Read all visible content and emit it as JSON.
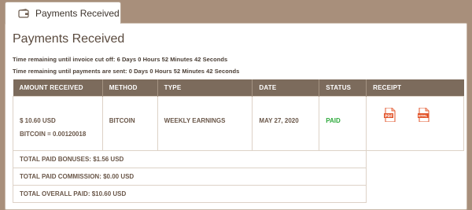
{
  "tab": {
    "label": "Payments Received",
    "icon": "wallet-icon"
  },
  "page": {
    "title": "Payments Received",
    "invoice_cutoff": "Time remaining until invoice cut off: 6 Days 0 Hours 52 Minutes 42 Seconds",
    "payments_sent": "Time remaining until payments are sent: 0 Days 0 Hours 52 Minutes 42 Seconds"
  },
  "table": {
    "headers": [
      "AMOUNT RECEIVED",
      "METHOD",
      "TYPE",
      "DATE",
      "STATUS",
      "RECEIPT"
    ],
    "row": {
      "amount": "$ 10.60 USD",
      "amount_btc": "BITCOIN = 0.00120018",
      "method": "BITCOIN",
      "type": "WEEKLY EARNINGS",
      "date": "MAY 27, 2020",
      "status": "PAID",
      "receipt_icons": [
        "pdf-icon",
        "html-icon"
      ]
    },
    "totals": {
      "bonuses": "TOTAL PAID BONUSES: $1.56 USD",
      "commission": "TOTAL PAID COMMISSION: $0.00 USD",
      "overall": "TOTAL OVERALL PAID: $10.60 USD"
    }
  },
  "colors": {
    "background": "#a88f7b",
    "header": "#7c6b5c",
    "paid": "#2eaa3c",
    "icon": "#e2552b"
  }
}
